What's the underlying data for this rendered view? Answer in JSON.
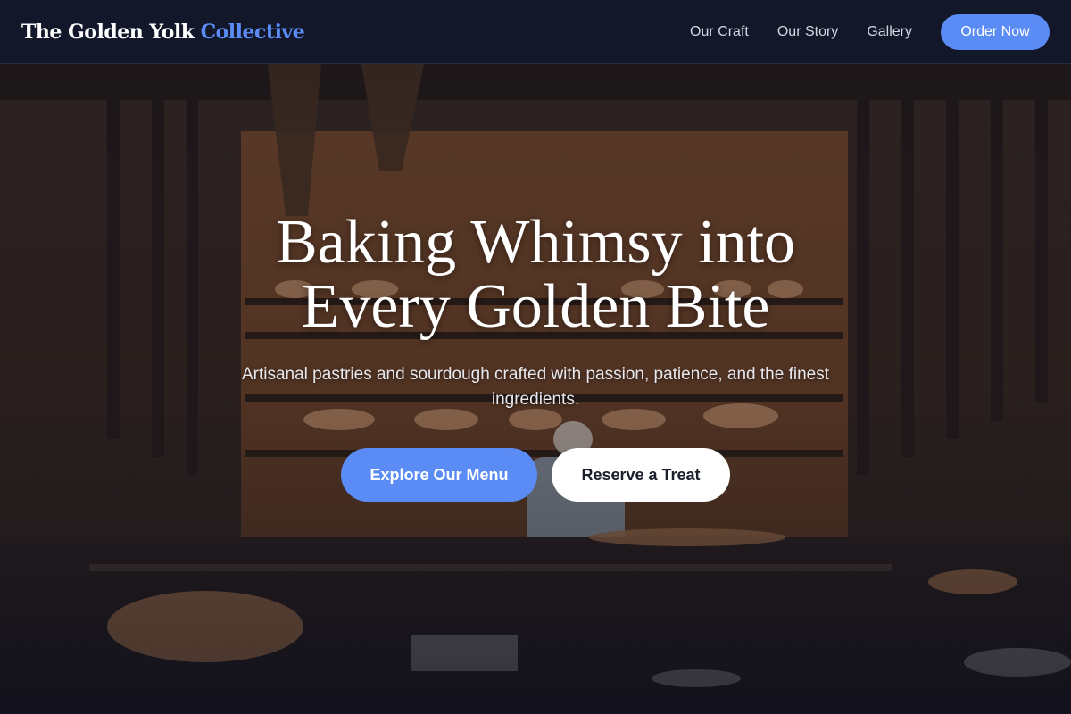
{
  "header": {
    "brand_main": "The Golden Yolk",
    "brand_accent": "Collective",
    "nav": [
      {
        "label": "Our Craft"
      },
      {
        "label": "Our Story"
      },
      {
        "label": "Gallery"
      }
    ],
    "cta_label": "Order Now"
  },
  "hero": {
    "title_line1": "Baking Whimsy into",
    "title_line2": "Every Golden Bite",
    "subtitle": "Artisanal pastries and sourdough crafted with passion, patience, and the finest ingredients.",
    "primary_button": "Explore Our Menu",
    "secondary_button": "Reserve a Treat",
    "image_description_icon": "bakery-interior-photo"
  },
  "colors": {
    "header_bg": "#121829",
    "accent": "#5b8cf5",
    "text_light": "#ffffff",
    "button_secondary_bg": "#ffffff"
  }
}
